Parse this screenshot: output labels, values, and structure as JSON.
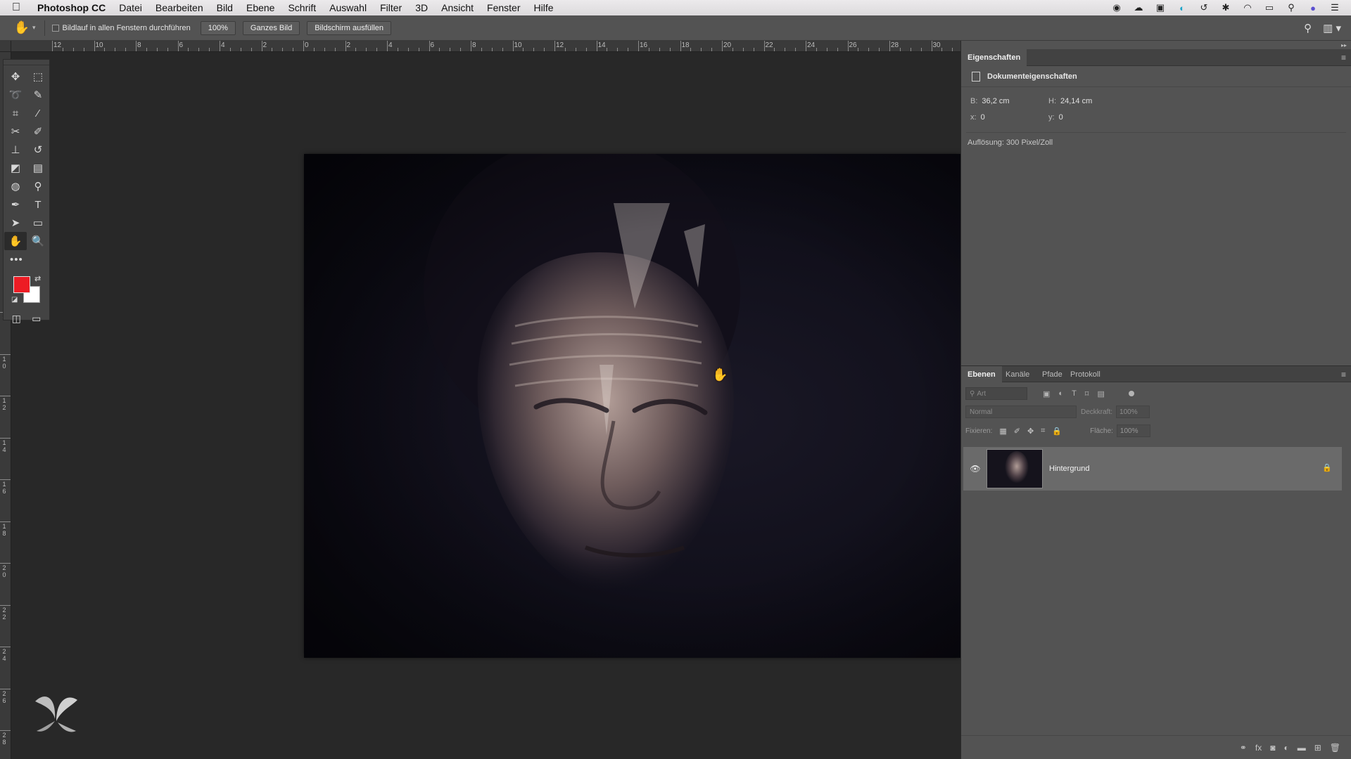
{
  "menubar": {
    "app_name": "Photoshop CC",
    "items": [
      "Datei",
      "Bearbeiten",
      "Bild",
      "Ebene",
      "Schrift",
      "Auswahl",
      "Filter",
      "3D",
      "Ansicht",
      "Fenster",
      "Hilfe"
    ],
    "status_icons": [
      "record-icon",
      "creative-cloud-icon",
      "display-icon",
      "sync-icon",
      "time-machine-icon",
      "bluetooth-icon",
      "wifi-icon",
      "airplay-icon",
      "spotlight-icon",
      "siri-icon",
      "notification-center-icon"
    ]
  },
  "options_bar": {
    "tool_icon": "hand-tool-icon",
    "scroll_all_label": "Bildlauf in allen Fenstern durchführen",
    "zoom_button": "100%",
    "fit_button": "Ganzes Bild",
    "fill_button": "Bildschirm ausfüllen"
  },
  "ruler": {
    "top_labels": [
      "12",
      "10",
      "8",
      "6",
      "4",
      "2",
      "0",
      "2",
      "4",
      "6",
      "8",
      "10",
      "12",
      "14",
      "16",
      "18",
      "20",
      "22",
      "24",
      "26",
      "28",
      "30"
    ],
    "left_labels": [
      "8",
      "1\n0",
      "1\n2",
      "1\n4",
      "1\n6",
      "1\n8",
      "2\n0",
      "2\n2",
      "2\n4",
      "2\n6",
      "2\n8"
    ]
  },
  "toolbar": {
    "tools": [
      {
        "name": "move-tool-icon",
        "glyph": "✥"
      },
      {
        "name": "marquee-tool-icon",
        "glyph": "⬚"
      },
      {
        "name": "lasso-tool-icon",
        "glyph": "➰"
      },
      {
        "name": "quick-selection-tool-icon",
        "glyph": "✎"
      },
      {
        "name": "crop-tool-icon",
        "glyph": "⌗"
      },
      {
        "name": "eyedropper-tool-icon",
        "glyph": "⁄"
      },
      {
        "name": "healing-tool-icon",
        "glyph": "✂"
      },
      {
        "name": "brush-tool-icon",
        "glyph": "✐"
      },
      {
        "name": "stamp-tool-icon",
        "glyph": "⊥"
      },
      {
        "name": "history-brush-tool-icon",
        "glyph": "↺"
      },
      {
        "name": "eraser-tool-icon",
        "glyph": "◩"
      },
      {
        "name": "gradient-tool-icon",
        "glyph": "▤"
      },
      {
        "name": "blur-tool-icon",
        "glyph": "◍"
      },
      {
        "name": "dodge-tool-icon",
        "glyph": "⚲"
      },
      {
        "name": "pen-tool-icon",
        "glyph": "✒"
      },
      {
        "name": "type-tool-icon",
        "glyph": "T"
      },
      {
        "name": "path-selection-tool-icon",
        "glyph": "➤"
      },
      {
        "name": "rectangle-tool-icon",
        "glyph": "▭"
      },
      {
        "name": "hand-tool-icon",
        "glyph": "✋"
      },
      {
        "name": "zoom-tool-icon",
        "glyph": "🔍"
      }
    ],
    "more_glyph": "•••",
    "foreground_color": "#ed1c24",
    "background_color": "#ffffff"
  },
  "properties_panel": {
    "tab": "Eigenschaften",
    "section_title": "Dokumenteigenschaften",
    "width_label": "B:",
    "width_value": "36,2 cm",
    "height_label": "H:",
    "height_value": "24,14 cm",
    "x_label": "x:",
    "x_value": "0",
    "y_label": "y:",
    "y_value": "0",
    "resolution": "Auflösung: 300 Pixel/Zoll"
  },
  "layers_panel": {
    "tabs": [
      "Ebenen",
      "Kanäle",
      "Pfade",
      "Protokoll"
    ],
    "active_tab": "Ebenen",
    "search_placeholder": "Art",
    "blend_mode": "Normal",
    "opacity_label": "Deckkraft:",
    "opacity_value": "100%",
    "lock_label": "Fixieren:",
    "fill_label": "Fläche:",
    "fill_value": "100%",
    "layers": [
      {
        "name": "Hintergrund",
        "visible": true,
        "locked": true
      }
    ],
    "footer_icons": [
      "link-icon",
      "fx-icon",
      "mask-icon",
      "adjustment-icon",
      "folder-icon",
      "new-layer-icon",
      "trash-icon"
    ]
  }
}
